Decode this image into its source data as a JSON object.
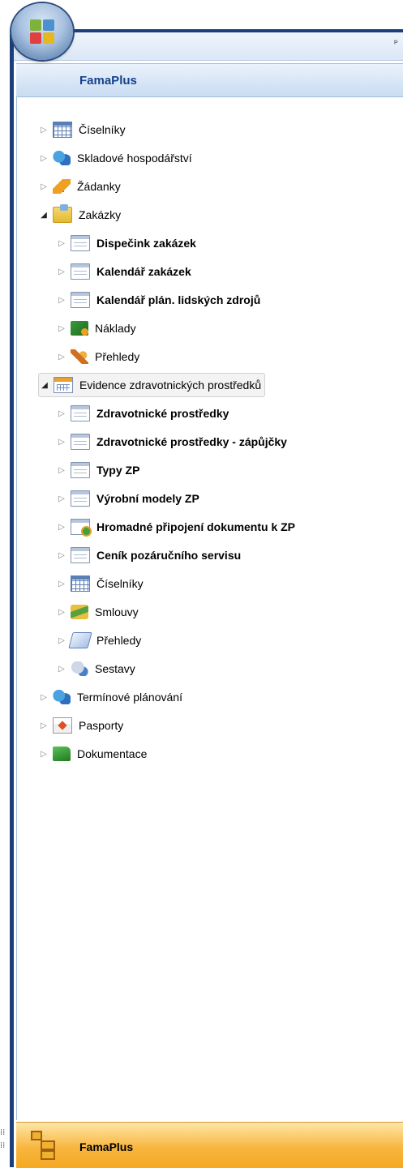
{
  "window": {
    "pin_icon": "pin-icon"
  },
  "header": {
    "title": "FamaPlus"
  },
  "tree": {
    "ciselniky": "Číselníky",
    "sklad": "Skladové hospodářství",
    "zadanky": "Žádanky",
    "zakazky": "Zakázky",
    "dispecink": "Dispečink zakázek",
    "kalendar": "Kalendář zakázek",
    "kalendar_plan": "Kalendář plán. lidských zdrojů",
    "naklady": "Náklady",
    "prehledy": "Přehledy",
    "evidence": "Evidence zdravotnických prostředků",
    "zp": "Zdravotnické prostředky",
    "zp_zapujcky": "Zdravotnické prostředky - zápůjčky",
    "typy": "Typy ZP",
    "modely": "Výrobní modely ZP",
    "hromadne": "Hromadné připojení dokumentu k ZP",
    "cenik": "Ceník pozáručního servisu",
    "ciselniky2": "Číselníky",
    "smlouvy": "Smlouvy",
    "prehledy2": "Přehledy",
    "sestavy": "Sestavy",
    "terminove": "Termínové plánování",
    "pasporty": "Pasporty",
    "dokumentace": "Dokumentace"
  },
  "footer": {
    "title": "FamaPlus"
  }
}
